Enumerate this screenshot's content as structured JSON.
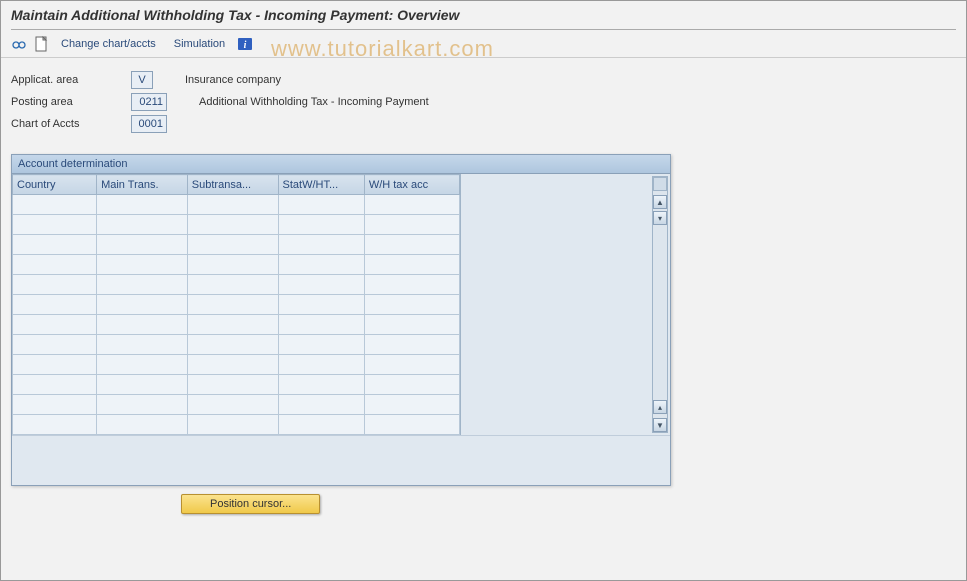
{
  "title": "Maintain Additional Withholding Tax - Incoming Payment: Overview",
  "watermark": "www.tutorialkart.com",
  "toolbar": {
    "change_chart_label": "Change chart/accts",
    "simulation_label": "Simulation"
  },
  "form": {
    "applicat_area": {
      "label": "Applicat. area",
      "value": "V",
      "desc": "Insurance company"
    },
    "posting_area": {
      "label": "Posting area",
      "value": "0211",
      "desc": "Additional Withholding Tax - Incoming Payment"
    },
    "chart_of_accts": {
      "label": "Chart of Accts",
      "value": "0001",
      "desc": ""
    }
  },
  "panel": {
    "title": "Account determination",
    "columns": [
      "Country",
      "Main Trans.",
      "Subtransa...",
      "StatW/HT...",
      "W/H tax acc"
    ],
    "row_count": 12
  },
  "buttons": {
    "position_cursor": "Position cursor..."
  }
}
